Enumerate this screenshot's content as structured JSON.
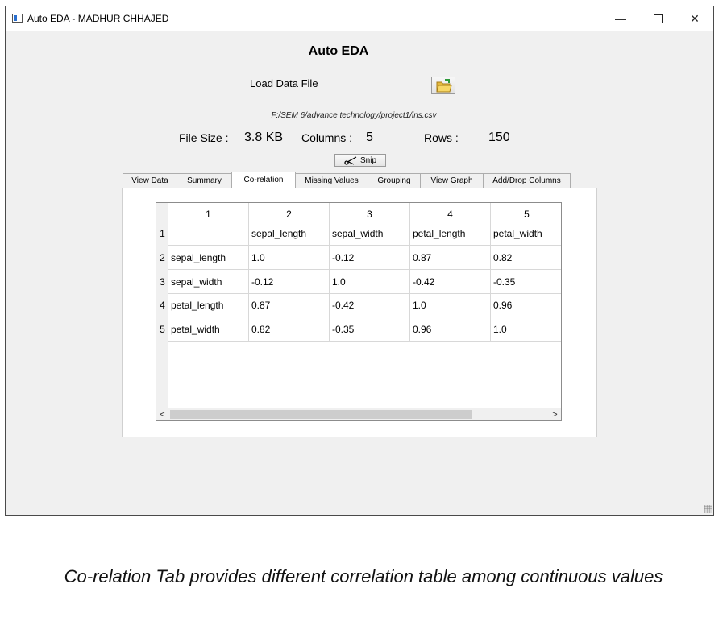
{
  "window": {
    "title": "Auto EDA - MADHUR CHHAJED",
    "min": "—",
    "close": "✕"
  },
  "app_title": "Auto EDA",
  "load": {
    "label": "Load Data File",
    "path": "F:/SEM 6/advance technology/project1/iris.csv"
  },
  "stats": {
    "file_size_label": "File Size :",
    "file_size_value": "3.8 KB",
    "columns_label": "Columns :",
    "columns_value": "5",
    "rows_label": "Rows :",
    "rows_value": "150"
  },
  "snip_label": "Snip",
  "tabs": [
    {
      "label": "View Data"
    },
    {
      "label": "Summary"
    },
    {
      "label": "Co-relation"
    },
    {
      "label": "Missing Values"
    },
    {
      "label": "Grouping"
    },
    {
      "label": "View Graph"
    },
    {
      "label": "Add/Drop Columns"
    }
  ],
  "active_tab": "Co-relation",
  "table": {
    "col_headers": [
      "1",
      "2",
      "3",
      "4",
      "5"
    ],
    "row_headers": [
      "1",
      "2",
      "3",
      "4",
      "5"
    ],
    "rows": [
      [
        "",
        "sepal_length",
        "sepal_width",
        "petal_length",
        "petal_width"
      ],
      [
        "sepal_length",
        "1.0",
        "-0.12",
        "0.87",
        "0.82"
      ],
      [
        "sepal_width",
        "-0.12",
        "1.0",
        "-0.42",
        "-0.35"
      ],
      [
        "petal_length",
        "0.87",
        "-0.42",
        "1.0",
        "0.96"
      ],
      [
        "petal_width",
        "0.82",
        "-0.35",
        "0.96",
        "1.0"
      ]
    ],
    "scroll_left": "<",
    "scroll_right": ">"
  },
  "caption": "Co-relation Tab provides different correlation table among continuous values",
  "icons": {
    "folder": "folder-open-icon",
    "snip": "scissors-icon",
    "app": "app-window-icon"
  }
}
